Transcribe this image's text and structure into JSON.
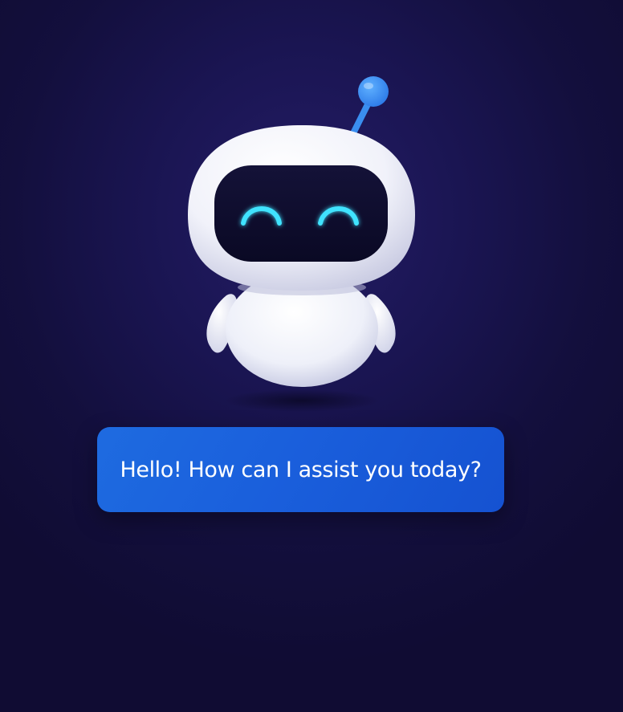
{
  "chat": {
    "message": "Hello! How can I assist you today?"
  },
  "icons": {
    "mascot": "robot-mascot-icon"
  },
  "colors": {
    "background": "#130f3d",
    "bubble": "#1a5fdc",
    "eye_glow": "#3fe3ff",
    "antenna": "#3a8ef0",
    "robot_body": "#ffffff",
    "visor": "#0d0b2e"
  }
}
